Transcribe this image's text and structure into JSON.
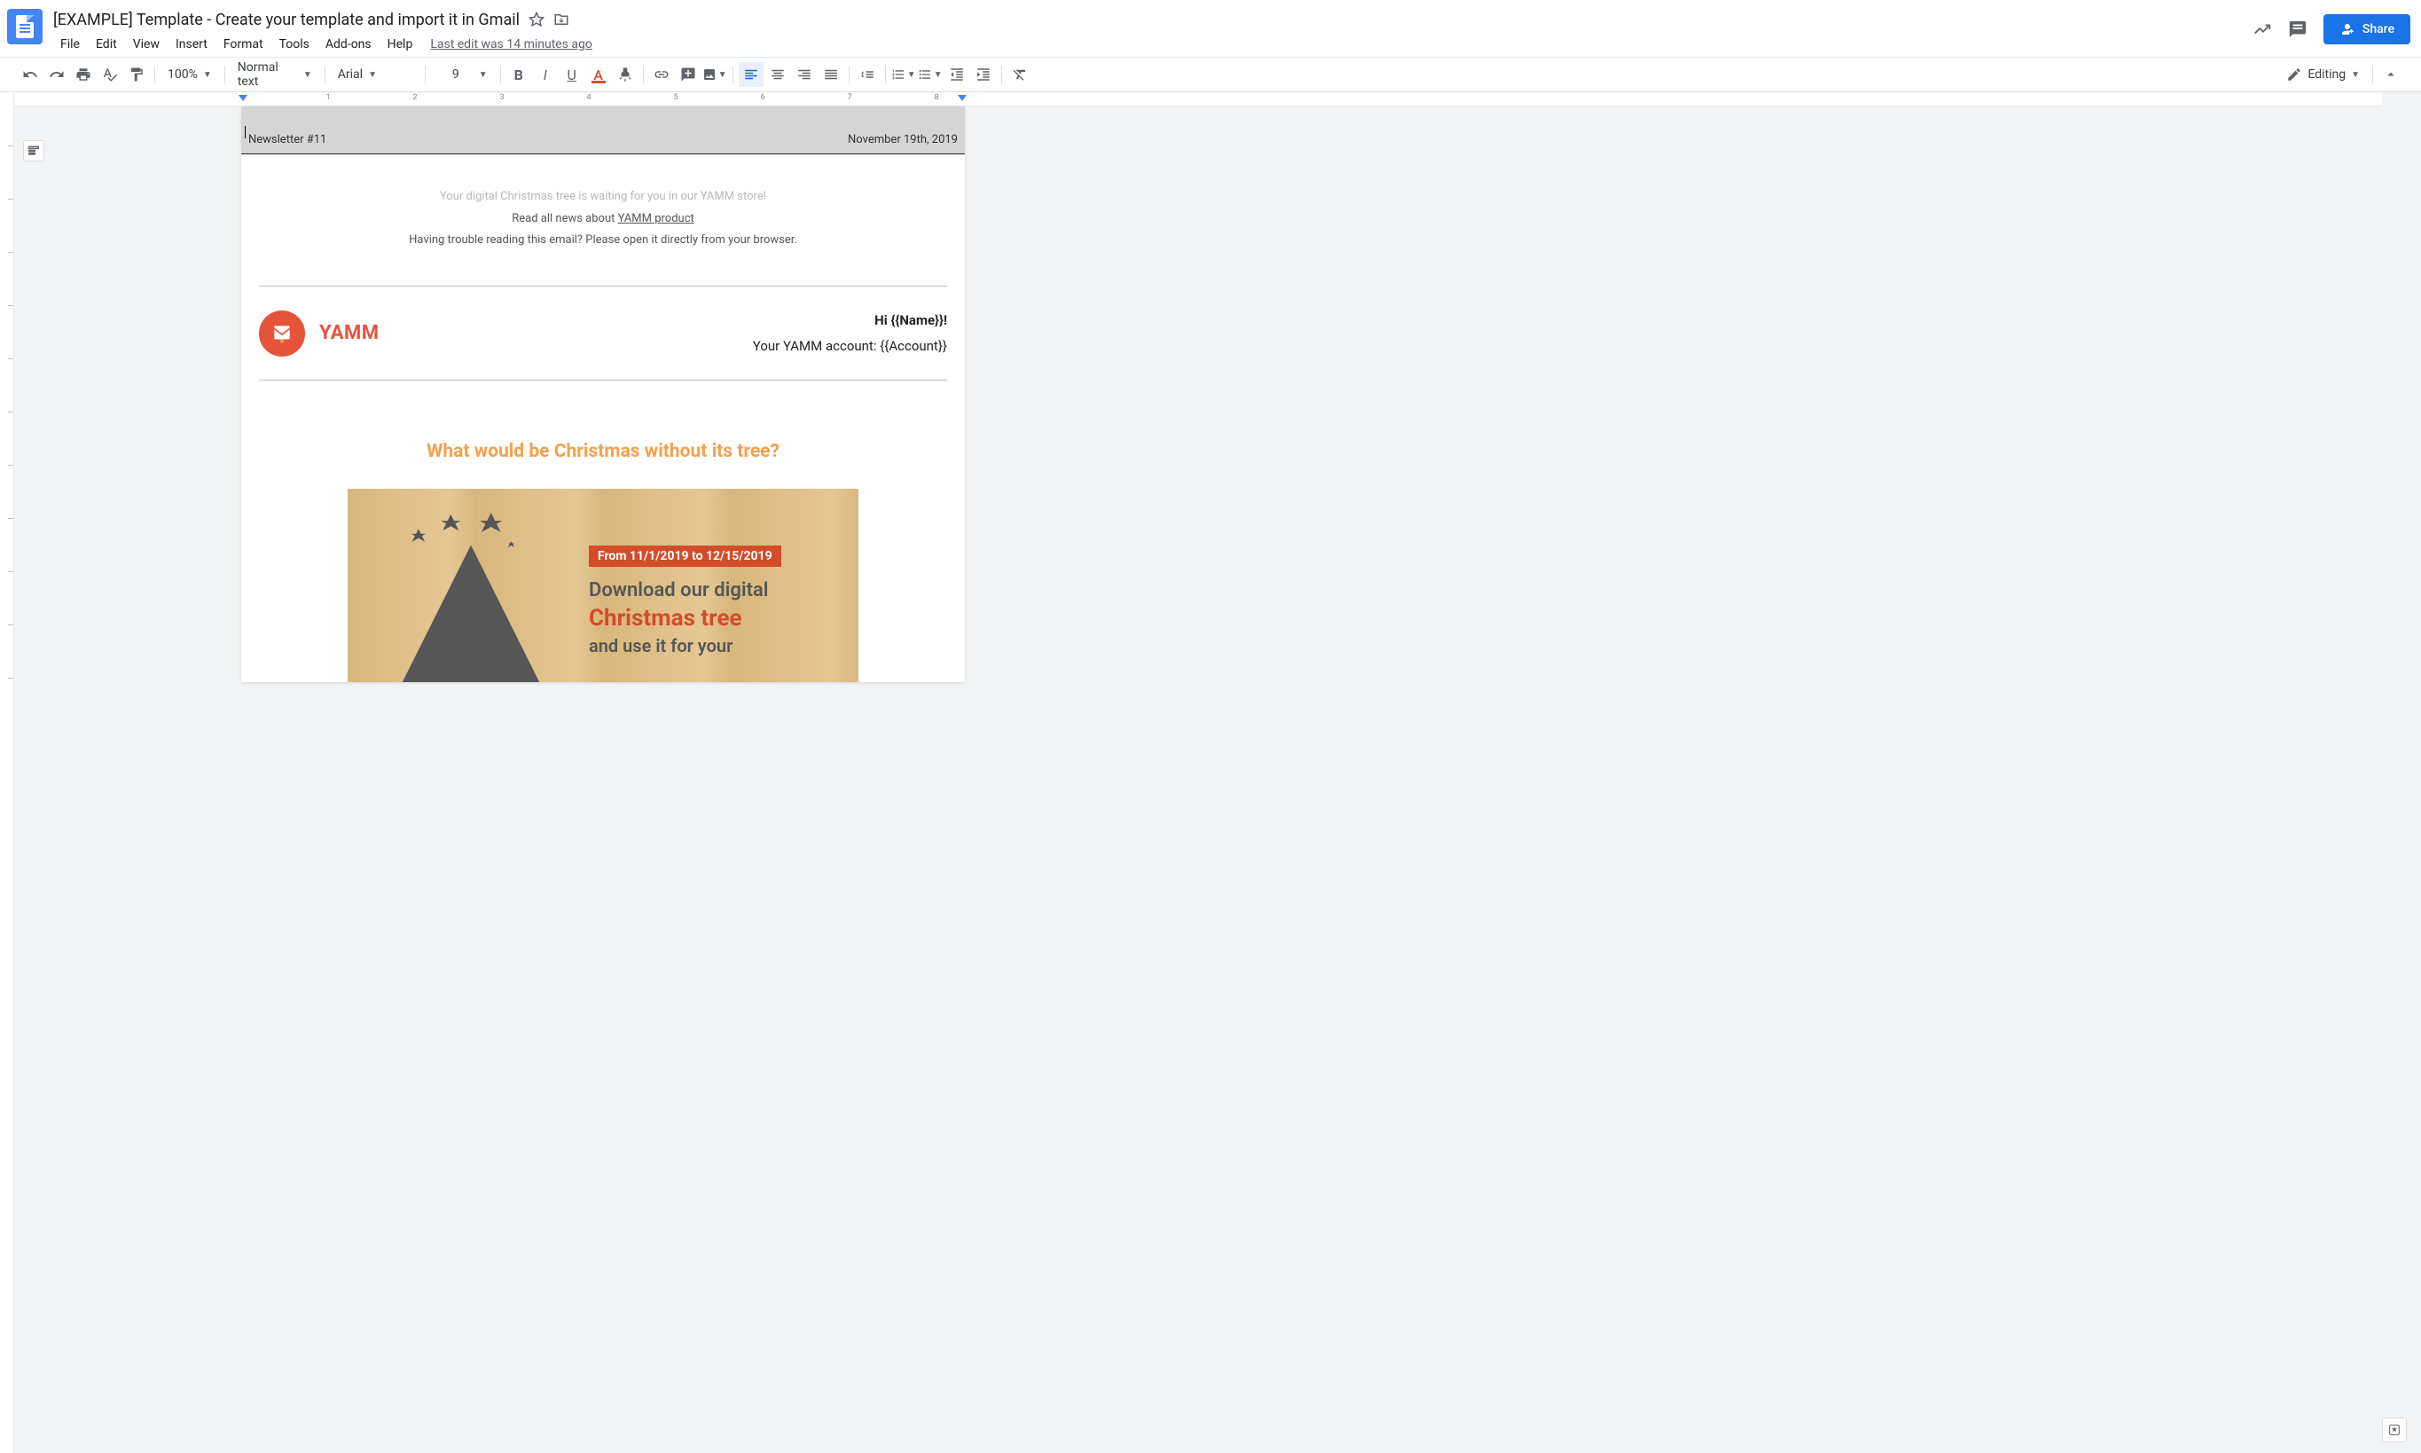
{
  "header": {
    "title": "[EXAMPLE] Template - Create your template and import it in Gmail",
    "menu": [
      "File",
      "Edit",
      "View",
      "Insert",
      "Format",
      "Tools",
      "Add-ons",
      "Help"
    ],
    "last_edit": "Last edit was 14 minutes ago",
    "share": "Share"
  },
  "toolbar": {
    "zoom": "100%",
    "style": "Normal text",
    "font": "Arial",
    "font_size": "9",
    "mode": "Editing"
  },
  "ruler": {
    "numbers": [
      "1",
      "2",
      "3",
      "4",
      "5",
      "6",
      "7",
      "8"
    ]
  },
  "document": {
    "newsletter_no": "Newsletter #11",
    "date": "November 19th, 2019",
    "intro_line1": "Your digital Christmas tree is waiting for you in our YAMM store!",
    "intro_line2_prefix": "Read all news about ",
    "intro_line2_link": "YAMM product",
    "intro_line3": "Having trouble reading this email? Please open it directly from your browser.",
    "brand_name": "YAMM",
    "greeting": "Hi {{Name}}!",
    "account_line": "Your YAMM account: {{Account}}",
    "headline": "What would be Christmas without its tree?",
    "promo_badge": "From 11/1/2019 to 12/15/2019",
    "promo_line1": "Download our digital",
    "promo_line2": "Christmas tree",
    "promo_line3": "and use it for your"
  }
}
